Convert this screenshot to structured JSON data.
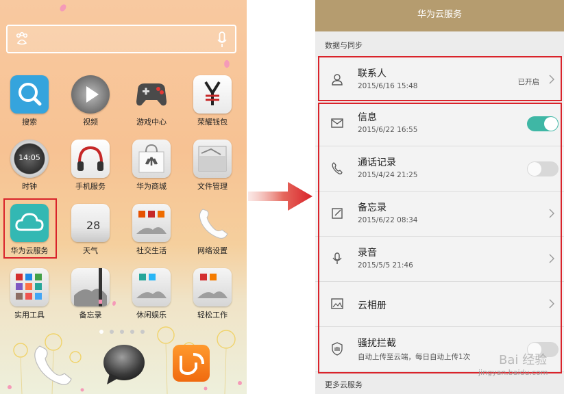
{
  "launcher": {
    "apps": [
      {
        "label": "搜索",
        "icon": "magnifier-icon"
      },
      {
        "label": "视频",
        "icon": "video-play-icon"
      },
      {
        "label": "游戏中心",
        "icon": "gamepad-icon"
      },
      {
        "label": "荣耀钱包",
        "icon": "wallet-icon"
      },
      {
        "label": "时钟",
        "icon": "clock-icon"
      },
      {
        "label": "手机服务",
        "icon": "headphones-icon"
      },
      {
        "label": "华为商城",
        "icon": "shopping-bag-icon"
      },
      {
        "label": "文件管理",
        "icon": "folder-icon"
      },
      {
        "label": "华为云服务",
        "icon": "cloud-icon"
      },
      {
        "label": "天气",
        "icon": "weather-icon"
      },
      {
        "label": "社交生活",
        "icon": "social-folder-icon"
      },
      {
        "label": "网络设置",
        "icon": "phone-handset-icon"
      },
      {
        "label": "实用工具",
        "icon": "tools-folder-icon"
      },
      {
        "label": "备忘录",
        "icon": "memo-icon"
      },
      {
        "label": "休闲娱乐",
        "icon": "entertainment-folder-icon"
      },
      {
        "label": "轻松工作",
        "icon": "work-folder-icon"
      }
    ],
    "clock_text": "14:05",
    "weather_temp": "28",
    "page_indicator": {
      "count": 5,
      "active": 0
    }
  },
  "cloud": {
    "title": "华为云服务",
    "section_header": "数据与同步",
    "footer_section": "更多云服务",
    "rows": [
      {
        "title": "联系人",
        "subtitle": "2015/6/16 15:48",
        "status": "已开启",
        "control": "chevron",
        "icon": "person-icon"
      },
      {
        "title": "信息",
        "subtitle": "2015/6/22 16:55",
        "control": "toggle",
        "toggle_on": true,
        "icon": "envelope-icon"
      },
      {
        "title": "通话记录",
        "subtitle": "2015/4/24 21:25",
        "control": "toggle",
        "toggle_on": false,
        "icon": "phone-icon"
      },
      {
        "title": "备忘录",
        "subtitle": "2015/6/22 08:34",
        "control": "chevron",
        "icon": "note-edit-icon"
      },
      {
        "title": "录音",
        "subtitle": "2015/5/5 21:46",
        "control": "chevron",
        "icon": "microphone-icon"
      },
      {
        "title": "云相册",
        "subtitle": "",
        "control": "chevron",
        "icon": "photo-album-icon"
      },
      {
        "title": "骚扰拦截",
        "subtitle": "自动上传至云端，每日自动上传1次",
        "control": "toggle",
        "toggle_on": false,
        "icon": "hand-stop-icon"
      }
    ]
  },
  "watermark": {
    "brand": "Bai 经验",
    "url": "jingyan.baidu.com"
  },
  "colors": {
    "accent_teal": "#3fb7a5",
    "title_bar": "#b59c6f",
    "highlight_red": "#d9232a",
    "arrow_red": "#e23b30"
  }
}
